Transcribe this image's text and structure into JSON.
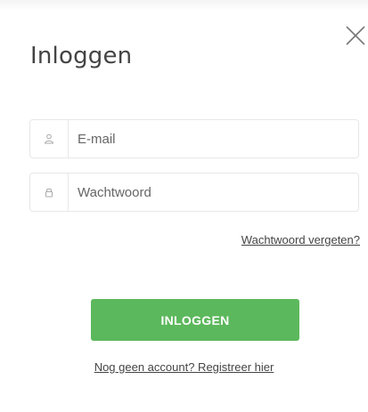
{
  "modal": {
    "title": "Inloggen",
    "close_icon": "close-icon"
  },
  "form": {
    "email": {
      "placeholder": "E-mail",
      "value": "",
      "icon": "user-icon"
    },
    "password": {
      "placeholder": "Wachtwoord",
      "value": "",
      "icon": "lock-icon"
    },
    "forgot_link": "Wachtwoord vergeten?",
    "submit_label": "INLOGGEN",
    "register_link": "Nog geen account? Registreer hier"
  },
  "colors": {
    "primary": "#5cb85c",
    "text": "#444444",
    "border": "#e7e7e7"
  }
}
